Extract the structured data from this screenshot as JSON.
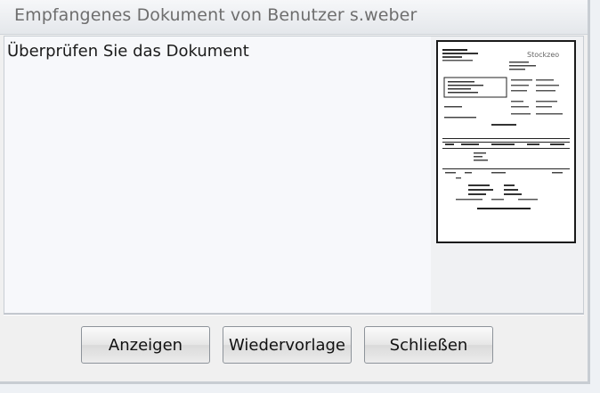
{
  "window": {
    "title": "Empfangenes Dokument von Benutzer s.weber"
  },
  "content": {
    "message": "Überprüfen Sie das Dokument"
  },
  "preview": {
    "logo_text": "Stockzeo"
  },
  "buttons": {
    "show_label": "Anzeigen",
    "resubmit_label": "Wiedervorlage",
    "close_label": "Schließen"
  }
}
